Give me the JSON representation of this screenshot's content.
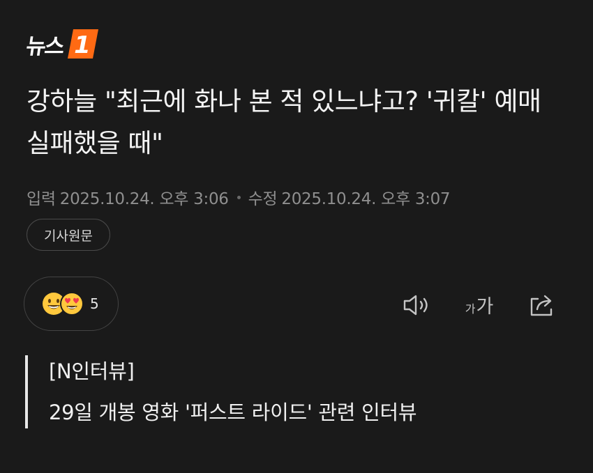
{
  "header": {
    "logo_text": "뉴스",
    "logo_mark_text": "1",
    "brand_color": "#ff6a13"
  },
  "article": {
    "title": "강하늘 \"최근에 화나 본 적 있느냐고? '귀칼' 예매 실패했을 때\"",
    "input_label": "입력",
    "input_date": "2025.10.24. 오후 3:06",
    "edit_label": "수정",
    "edit_date": "2025.10.24. 오후 3:07",
    "original_button_label": "기사원문"
  },
  "reactions": {
    "count": "5",
    "icons": [
      "grinning-face-icon",
      "heart-eyes-face-icon"
    ]
  },
  "toolbar": {
    "audio_icon": "speaker-icon",
    "font_size_small": "가",
    "font_size_large": "가",
    "share_icon": "share-icon"
  },
  "summary": {
    "lines": [
      "[N인터뷰]",
      "29일 개봉 영화 '퍼스트 라이드' 관련 인터뷰"
    ]
  }
}
